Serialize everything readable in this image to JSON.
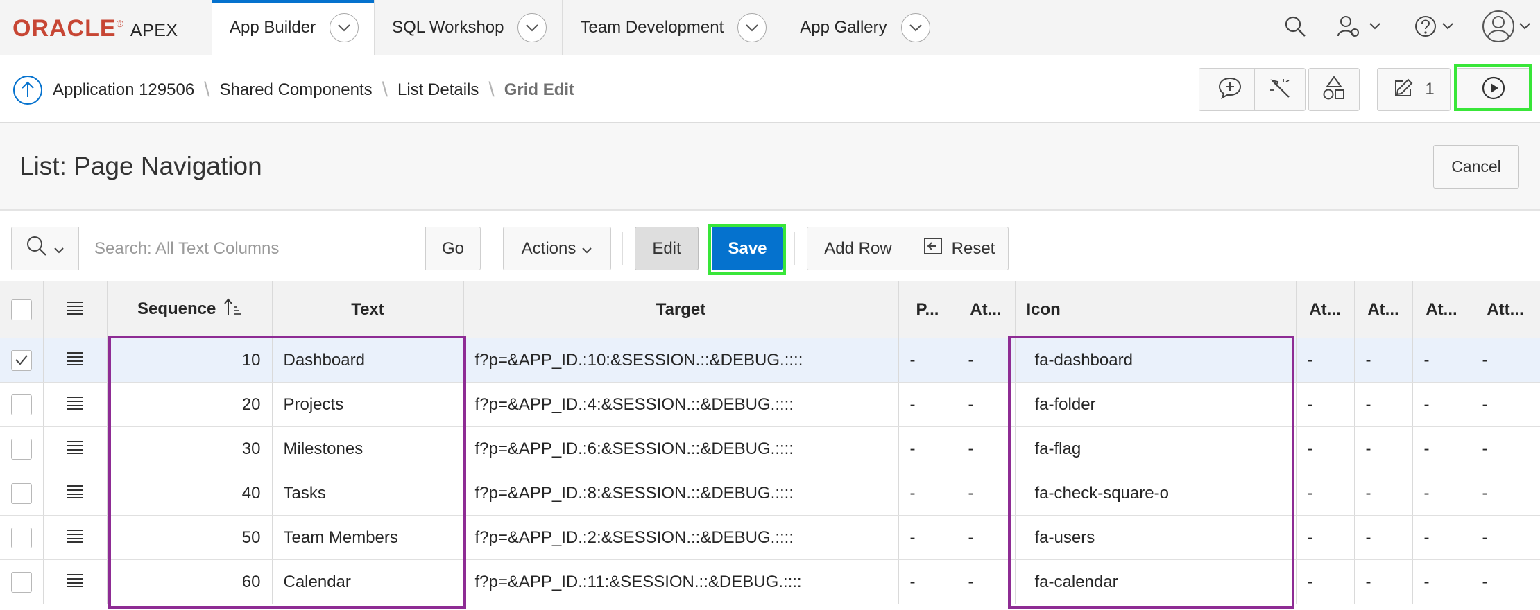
{
  "brand": {
    "oracle": "ORACLE",
    "reg": "®",
    "apex": "APEX"
  },
  "topnav": {
    "tabs": [
      {
        "label": "App Builder"
      },
      {
        "label": "SQL Workshop"
      },
      {
        "label": "Team Development"
      },
      {
        "label": "App Gallery"
      }
    ]
  },
  "breadcrumb": {
    "items": [
      {
        "label": "Application 129506"
      },
      {
        "label": "Shared Components"
      },
      {
        "label": "List Details"
      },
      {
        "label": "Grid Edit"
      }
    ]
  },
  "toolbar": {
    "edit_count": "1"
  },
  "page": {
    "title": "List: Page Navigation",
    "cancel_label": "Cancel"
  },
  "gridbar": {
    "search_placeholder": "Search: All Text Columns",
    "go_label": "Go",
    "actions_label": "Actions",
    "edit_label": "Edit",
    "save_label": "Save",
    "add_row_label": "Add Row",
    "reset_label": "Reset"
  },
  "grid": {
    "columns": [
      "Sequence",
      "Text",
      "Target",
      "P...",
      "At...",
      "Icon",
      "At...",
      "At...",
      "At...",
      "Att..."
    ],
    "rows": [
      {
        "checked": true,
        "sequence": "10",
        "text": "Dashboard",
        "target": "f?p=&APP_ID.:10:&SESSION.::&DEBUG.::::",
        "p": "-",
        "at": "-",
        "icon": "fa-dashboard",
        "a1": "-",
        "a2": "-",
        "a3": "-",
        "a4": "-"
      },
      {
        "checked": false,
        "sequence": "20",
        "text": "Projects",
        "target": "f?p=&APP_ID.:4:&SESSION.::&DEBUG.::::",
        "p": "-",
        "at": "-",
        "icon": "fa-folder",
        "a1": "-",
        "a2": "-",
        "a3": "-",
        "a4": "-"
      },
      {
        "checked": false,
        "sequence": "30",
        "text": "Milestones",
        "target": "f?p=&APP_ID.:6:&SESSION.::&DEBUG.::::",
        "p": "-",
        "at": "-",
        "icon": "fa-flag",
        "a1": "-",
        "a2": "-",
        "a3": "-",
        "a4": "-"
      },
      {
        "checked": false,
        "sequence": "40",
        "text": "Tasks",
        "target": "f?p=&APP_ID.:8:&SESSION.::&DEBUG.::::",
        "p": "-",
        "at": "-",
        "icon": "fa-check-square-o",
        "a1": "-",
        "a2": "-",
        "a3": "-",
        "a4": "-"
      },
      {
        "checked": false,
        "sequence": "50",
        "text": "Team Members",
        "target": "f?p=&APP_ID.:2:&SESSION.::&DEBUG.::::",
        "p": "-",
        "at": "-",
        "icon": "fa-users",
        "a1": "-",
        "a2": "-",
        "a3": "-",
        "a4": "-"
      },
      {
        "checked": false,
        "sequence": "60",
        "text": "Calendar",
        "target": "f?p=&APP_ID.:11:&SESSION.::&DEBUG.::::",
        "p": "-",
        "at": "-",
        "icon": "fa-calendar",
        "a1": "-",
        "a2": "-",
        "a3": "-",
        "a4": "-"
      }
    ]
  },
  "colors": {
    "brand_red": "#c74634",
    "primary_blue": "#0572ce",
    "highlight_green": "#39e639",
    "highlight_purple": "#8e2c94"
  }
}
